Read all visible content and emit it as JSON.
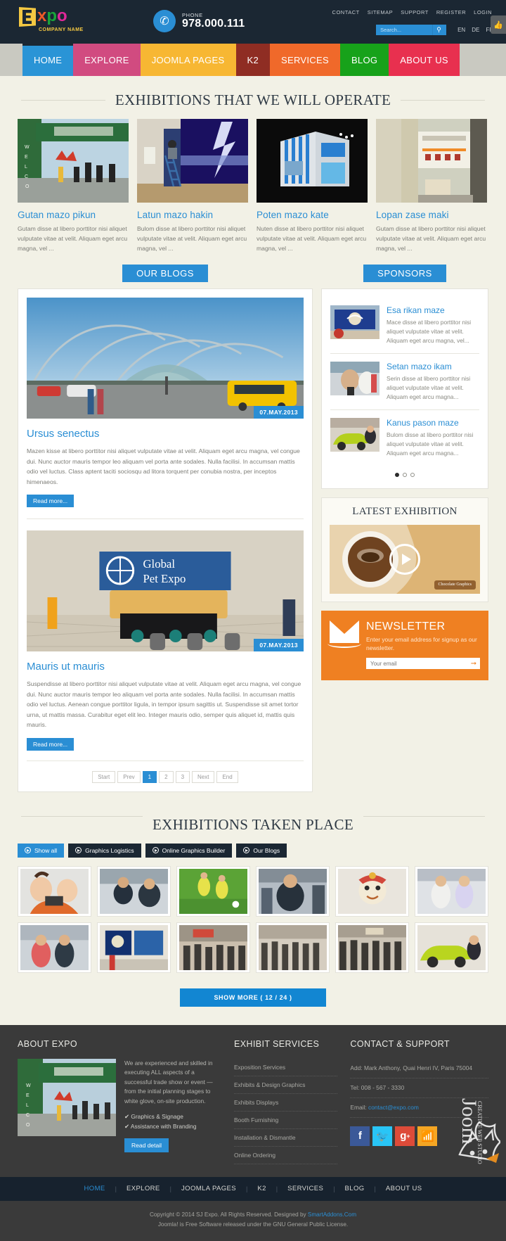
{
  "header": {
    "logo": {
      "e": "E",
      "x": "x",
      "p": "p",
      "o": "o",
      "subtitle": "COMPANY NAME"
    },
    "phone_label": "PHONE",
    "phone_number": "978.000.111",
    "top_links": [
      "CONTACT",
      "SITEMAP",
      "SUPPORT",
      "REGISTER",
      "LOGIN"
    ],
    "search_placeholder": "Search...",
    "search_value": "",
    "languages": [
      "EN",
      "DE",
      "FR"
    ]
  },
  "nav": [
    {
      "label": "HOME",
      "color": "#2a94d6",
      "active": true
    },
    {
      "label": "EXPLORE",
      "color": "#d14b80",
      "active": false
    },
    {
      "label": "JOOMLA PAGES",
      "color": "#f7b733",
      "active": false
    },
    {
      "label": "K2",
      "color": "#8f2d23",
      "active": false
    },
    {
      "label": "SERVICES",
      "color": "#f0692a",
      "active": false
    },
    {
      "label": "BLOG",
      "color": "#17a21a",
      "active": false
    },
    {
      "label": "ABOUT US",
      "color": "#e8304f",
      "active": false
    }
  ],
  "exhibitions_operate": {
    "title": "EXHIBITIONS THAT WE WILL OPERATE",
    "items": [
      {
        "title": "Gutan mazo pikun",
        "text": "Gutam disse at libero porttitor nisi aliquet vulputate vitae at velit. Aliquam eget arcu magna, vel ..."
      },
      {
        "title": "Latun mazo hakin",
        "text": "Bulom disse at libero porttitor nisi aliquet vulputate vitae at velit. Aliquam eget arcu magna, vel ..."
      },
      {
        "title": "Poten mazo kate",
        "text": "Nuten disse at libero porttitor nisi aliquet vulputate vitae at velit. Aliquam eget arcu magna, vel ..."
      },
      {
        "title": "Lopan zase maki",
        "text": "Gutam disse at libero porttitor nisi aliquet vulputate vitae at velit. Aliquam eget arcu magna, vel ..."
      }
    ]
  },
  "blogs": {
    "badge": "OUR BLOGS",
    "posts": [
      {
        "date": "07.MAY.2013",
        "title": "Ursus senectus",
        "text": "Mazen kisse at libero porttitor nisi aliquet vulputate vitae at velit. Aliquam eget arcu magna, vel congue dui. Nunc auctor mauris tempor leo aliquam vel porta ante sodales. Nulla facilisi. In accumsan mattis odio vel luctus. Class aptent taciti sociosqu ad litora torquent per conubia nostra, per inceptos himenaeos.",
        "readmore": "Read more..."
      },
      {
        "date": "07.MAY.2013",
        "title": "Mauris ut mauris",
        "text": "Suspendisse at libero porttitor nisi aliquet vulputate vitae at velit. Aliquam eget arcu magna, vel congue dui. Nunc auctor mauris tempor leo aliquam vel porta ante sodales. Nulla facilisi. In accumsan mattis odio vel luctus. Aenean congue porttitor ligula, in tempor ipsum sagittis ut. Suspendisse sit amet tortor urna, ut mattis massa. Curabitur eget elit leo. Integer mauris odio, semper quis aliquet id, mattis quis mauris.",
        "readmore": "Read more..."
      }
    ],
    "pagination": [
      "Start",
      "Prev",
      "1",
      "2",
      "3",
      "Next",
      "End"
    ],
    "pagination_active": "1"
  },
  "sponsors": {
    "badge": "SPONSORS",
    "items": [
      {
        "title": "Esa rikan maze",
        "text": "Mace disse at libero porttitor nisi aliquet vulputate vitae at velit. Aliquam eget arcu magna, vel..."
      },
      {
        "title": "Setan mazo ikam",
        "text": "Serin disse at libero porttitor nisi aliquet vulputate vitae at velit. Aliquam eget arcu magna..."
      },
      {
        "title": "Kanus pason maze",
        "text": "Bulom disse at libero porttitor nisi aliquet vulputate vitae at velit. Aliquam eget arcu magna..."
      }
    ],
    "dots": 3,
    "active_dot": 0
  },
  "latest_exhibition": {
    "title": "LATEST EXHIBITION",
    "video_badge": "Chocolate Graphics"
  },
  "newsletter": {
    "title": "NEWSLETTER",
    "description": "Enter your email address for signup as our newsletter.",
    "placeholder": "Your email",
    "value": ""
  },
  "taken_place": {
    "title": "EXHIBITIONS TAKEN PLACE",
    "filters": [
      {
        "label": "Show all",
        "active": true
      },
      {
        "label": "Graphics Logistics",
        "active": false
      },
      {
        "label": "Online Graphics Builder",
        "active": false
      },
      {
        "label": "Our Blogs",
        "active": false
      }
    ],
    "gallery_count": 12,
    "show_more": "SHOW MORE ( 12 / 24 )"
  },
  "footer": {
    "about": {
      "heading": "ABOUT EXPO",
      "text": "We are experienced and skilled in executing ALL aspects of a successful trade show or event — from the initial planning stages to white glove, on-site production.",
      "ticks": [
        "Graphics & Signage",
        "Assistance with Branding"
      ],
      "button": "Read detail"
    },
    "services": {
      "heading": "EXHIBIT SERVICES",
      "links": [
        "Exposition Services",
        "Exhibits & Design Graphics",
        "Exhibits Displays",
        "Booth Furnishing",
        "Installation & Dismantle",
        "Online Ordering"
      ]
    },
    "contact": {
      "heading": "CONTACT & SUPPORT",
      "address": "Add: Mark Anthony, Quai Henri IV, Paris 75004",
      "tel": "Tel: 008 - 567 - 3330",
      "email_label": "Email:",
      "email": "contact@expo.com",
      "socials": [
        "facebook-icon",
        "twitter-icon",
        "google-plus-icon",
        "rss-icon"
      ]
    },
    "nav": [
      "HOME",
      "EXPLORE",
      "JOOMLA PAGES",
      "K2",
      "SERVICES",
      "BLOG",
      "ABOUT US"
    ],
    "nav_active": "HOME",
    "copyright_line1_pre": "Copyright © 2014 SJ Expo. All Rights Reserved. Designed by ",
    "copyright_link": "SmartAddons.Com",
    "copyright_line2": "Joomla! is Free Software released under the GNU General Public License.",
    "watermark": "JoomlArt Fox"
  }
}
